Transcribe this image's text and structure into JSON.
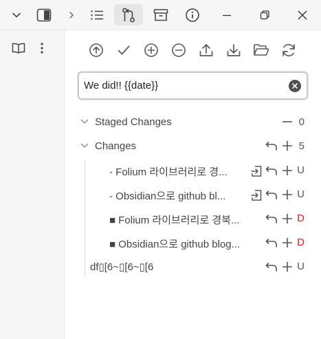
{
  "titlebar": {
    "icons": [
      "chevron-down-icon",
      "sidebar-toggle-icon",
      "chevron-right-icon",
      "list-icon",
      "git-pull-request-icon",
      "archive-icon",
      "info-icon",
      "minimize-icon",
      "restore-icon",
      "close-icon"
    ]
  },
  "rail": {
    "icons": [
      "book-open-icon",
      "more-vertical-icon"
    ]
  },
  "toolbar": {
    "icons": [
      "push-icon",
      "commit-icon",
      "stage-all-icon",
      "unstage-all-icon",
      "upload-icon",
      "download-icon",
      "folder-open-icon",
      "refresh-icon"
    ]
  },
  "commit": {
    "message": "We did!! {{date}}"
  },
  "staged": {
    "label": "Staged Changes",
    "count": "0"
  },
  "changes": {
    "label": "Changes",
    "count": "5",
    "files": [
      {
        "name": "- Folium 라이브러리로 경...",
        "status": "U",
        "has_open": true
      },
      {
        "name": "- Obsidian으로 github bl...",
        "status": "U",
        "has_open": true
      },
      {
        "name": "■ Folium 라이브러리로 경북...",
        "status": "D",
        "has_open": false
      },
      {
        "name": "■ Obsidian으로 github blog...",
        "status": "D",
        "has_open": false
      },
      {
        "name": "df▯[6~▯[6~▯[6",
        "status": "U",
        "has_open": false
      }
    ]
  },
  "colors": {
    "deleted": "#e0191b",
    "untracked": "#555555",
    "active_bg": "#e6e6e6"
  }
}
